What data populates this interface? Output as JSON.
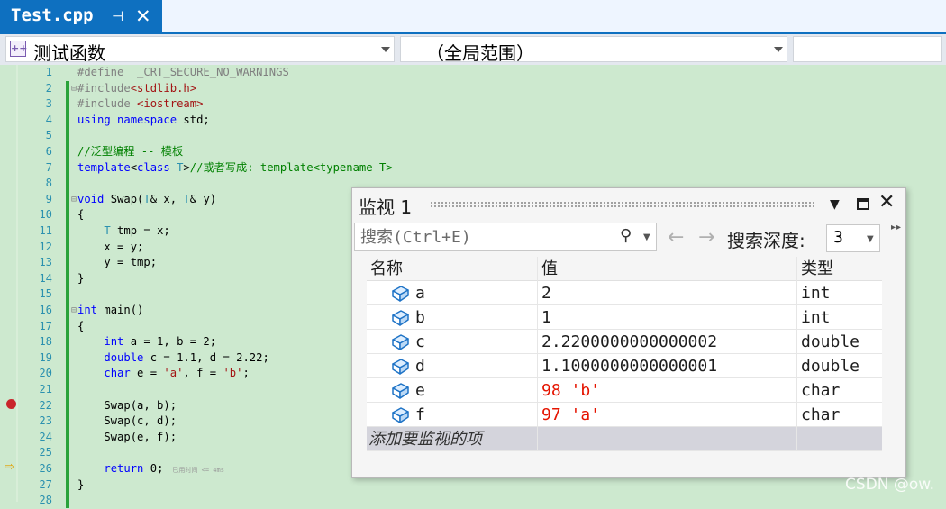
{
  "tab": {
    "title": "Test.cpp",
    "pin_icon": "pin-icon",
    "close_icon": "close-icon"
  },
  "navbar": {
    "project_label": "测试函数",
    "project_icon": "project-icon",
    "scope_label": "（全局范围）",
    "member_label": ""
  },
  "code_lines": [
    {
      "n": "1",
      "html": "<span class=\"pp\">#define  _CRT_SECURE_NO_WARNINGS</span>"
    },
    {
      "n": "2",
      "fold": "⊟",
      "html": "<span class=\"pp\">#include</span><span class=\"str\">&lt;stdlib.h&gt;</span>"
    },
    {
      "n": "3",
      "html": "<span class=\"pp\">#include </span><span class=\"str\">&lt;iostream&gt;</span>"
    },
    {
      "n": "4",
      "html": "<span class=\"kw\">using namespace</span> std;"
    },
    {
      "n": "5",
      "html": ""
    },
    {
      "n": "6",
      "html": "<span class=\"cm\">//泛型编程 -- 模板</span>"
    },
    {
      "n": "7",
      "html": "<span class=\"kw\">template</span>&lt;<span class=\"kw\">class</span> <span class=\"ty\">T</span>&gt;<span class=\"cm\">//或者写成: template&lt;typename T&gt;</span>"
    },
    {
      "n": "8",
      "html": ""
    },
    {
      "n": "9",
      "fold": "⊟",
      "html": "<span class=\"kw\">void</span> Swap(<span class=\"ty\">T</span>&amp; x, <span class=\"ty\">T</span>&amp; y)"
    },
    {
      "n": "10",
      "html": "{"
    },
    {
      "n": "11",
      "html": "    <span class=\"ty\">T</span> tmp = x;"
    },
    {
      "n": "12",
      "html": "    x = y;"
    },
    {
      "n": "13",
      "html": "    y = tmp;"
    },
    {
      "n": "14",
      "html": "}"
    },
    {
      "n": "15",
      "html": ""
    },
    {
      "n": "16",
      "fold": "⊟",
      "html": "<span class=\"kw\">int</span> main()"
    },
    {
      "n": "17",
      "html": "{"
    },
    {
      "n": "18",
      "html": "    <span class=\"kw\">int</span> a = 1, b = 2;"
    },
    {
      "n": "19",
      "html": "    <span class=\"kw\">double</span> c = 1.1, d = 2.22;"
    },
    {
      "n": "20",
      "html": "    <span class=\"kw\">char</span> e = <span class=\"str\">'a'</span>, f = <span class=\"str\">'b'</span>;"
    },
    {
      "n": "21",
      "html": ""
    },
    {
      "n": "22",
      "html": "    Swap(a, b);"
    },
    {
      "n": "23",
      "html": "    Swap(c, d);"
    },
    {
      "n": "24",
      "html": "    Swap(e, f);"
    },
    {
      "n": "25",
      "html": ""
    },
    {
      "n": "26",
      "html": "    <span class=\"kw\">return</span> 0;<span class=\"perf\">已用时间 &lt;= 4ms</span>"
    },
    {
      "n": "27",
      "html": "}"
    },
    {
      "n": "28",
      "html": ""
    }
  ],
  "breakpoint_line": "22",
  "current_line": "26",
  "watch": {
    "title": "监视 1",
    "search_placeholder": "搜索(Ctrl+E)",
    "search_icon": "search-icon",
    "depth_label": "搜索深度:",
    "depth_value": "3",
    "headers": {
      "name": "名称",
      "value": "值",
      "type": "类型"
    },
    "rows": [
      {
        "name": "a",
        "value": "2",
        "type": "int",
        "changed": false
      },
      {
        "name": "b",
        "value": "1",
        "type": "int",
        "changed": false
      },
      {
        "name": "c",
        "value": "2.2200000000000002",
        "type": "double",
        "changed": false
      },
      {
        "name": "d",
        "value": "1.1000000000000001",
        "type": "double",
        "changed": false
      },
      {
        "name": "e",
        "value": "98 'b'",
        "type": "char",
        "changed": true
      },
      {
        "name": "f",
        "value": "97 'a'",
        "type": "char",
        "changed": true
      }
    ],
    "add_item_text": "添加要监视的项"
  },
  "watermark": "CSDN @ow.",
  "colors": {
    "accent": "#0e70c0",
    "changed_value": "#e51400",
    "editor_bg": "#cde9cf",
    "changebar": "#2aa33a",
    "breakpoint": "#c9252b"
  }
}
